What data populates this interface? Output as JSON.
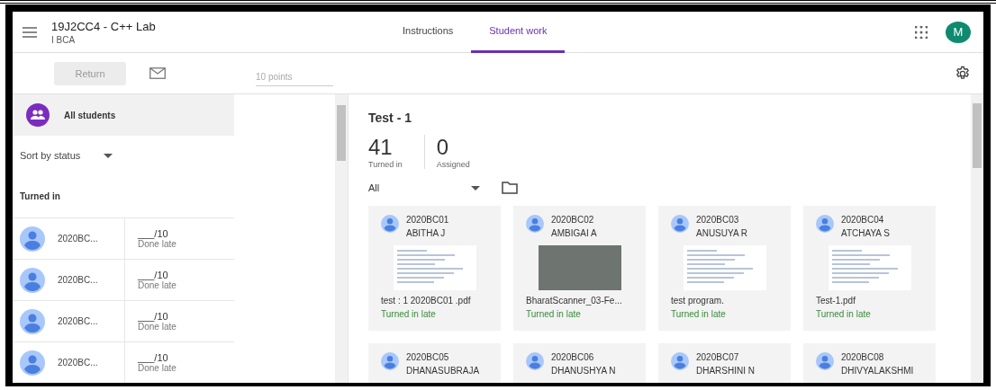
{
  "header": {
    "title": "19J2CC4 - C++ Lab",
    "subtitle": "I BCA",
    "account_initial": "M",
    "tabs": [
      {
        "label": "Instructions",
        "selected": false
      },
      {
        "label": "Student work",
        "selected": true
      }
    ]
  },
  "toolbar": {
    "return_button": {
      "label": "Return",
      "disabled": true
    },
    "points_placeholder": "10 points"
  },
  "sidebar": {
    "all_students": "All students",
    "sort": "Sort by status",
    "section": "Turned in",
    "students": [
      {
        "name": "2020BC...",
        "grade": "___/10",
        "status": "Done late"
      },
      {
        "name": "2020BC...",
        "grade": "___/10",
        "status": "Done late"
      },
      {
        "name": "2020BC...",
        "grade": "___/10",
        "status": "Done late"
      },
      {
        "name": "2020BC...",
        "grade": "___/10",
        "status": "Done late"
      }
    ]
  },
  "assignment": {
    "title": "Test - 1",
    "stats": [
      {
        "value": "41",
        "label": "Turned in"
      },
      {
        "value": "0",
        "label": "Assigned"
      }
    ],
    "filter": "All",
    "submissions": [
      {
        "id": "2020BC01",
        "name": "ABITHA J",
        "kind": "screenshot",
        "file": "test : 1 2020BC01 .pdf",
        "status": "Turned in late"
      },
      {
        "id": "2020BC02",
        "name": "AMBIGAI A",
        "kind": "photo",
        "file": "BharatScanner_03-Fe...",
        "status": "Turned in late"
      },
      {
        "id": "2020BC03",
        "name": "ANUSUYA R",
        "kind": "screenshot",
        "file": "test program.",
        "status": "Turned in late"
      },
      {
        "id": "2020BC04",
        "name": "ATCHAYA S",
        "kind": "screenshot",
        "file": "Test-1.pdf",
        "status": "Turned in late"
      },
      {
        "id": "2020BC05",
        "name": "DHANASUBRAJA",
        "kind": "none"
      },
      {
        "id": "2020BC06",
        "name": "DHANUSHYA N",
        "kind": "none"
      },
      {
        "id": "2020BC07",
        "name": "DHARSHINI N",
        "kind": "none"
      },
      {
        "id": "2020BC08",
        "name": "DHIVYALAKSHMI",
        "kind": "none"
      }
    ]
  }
}
